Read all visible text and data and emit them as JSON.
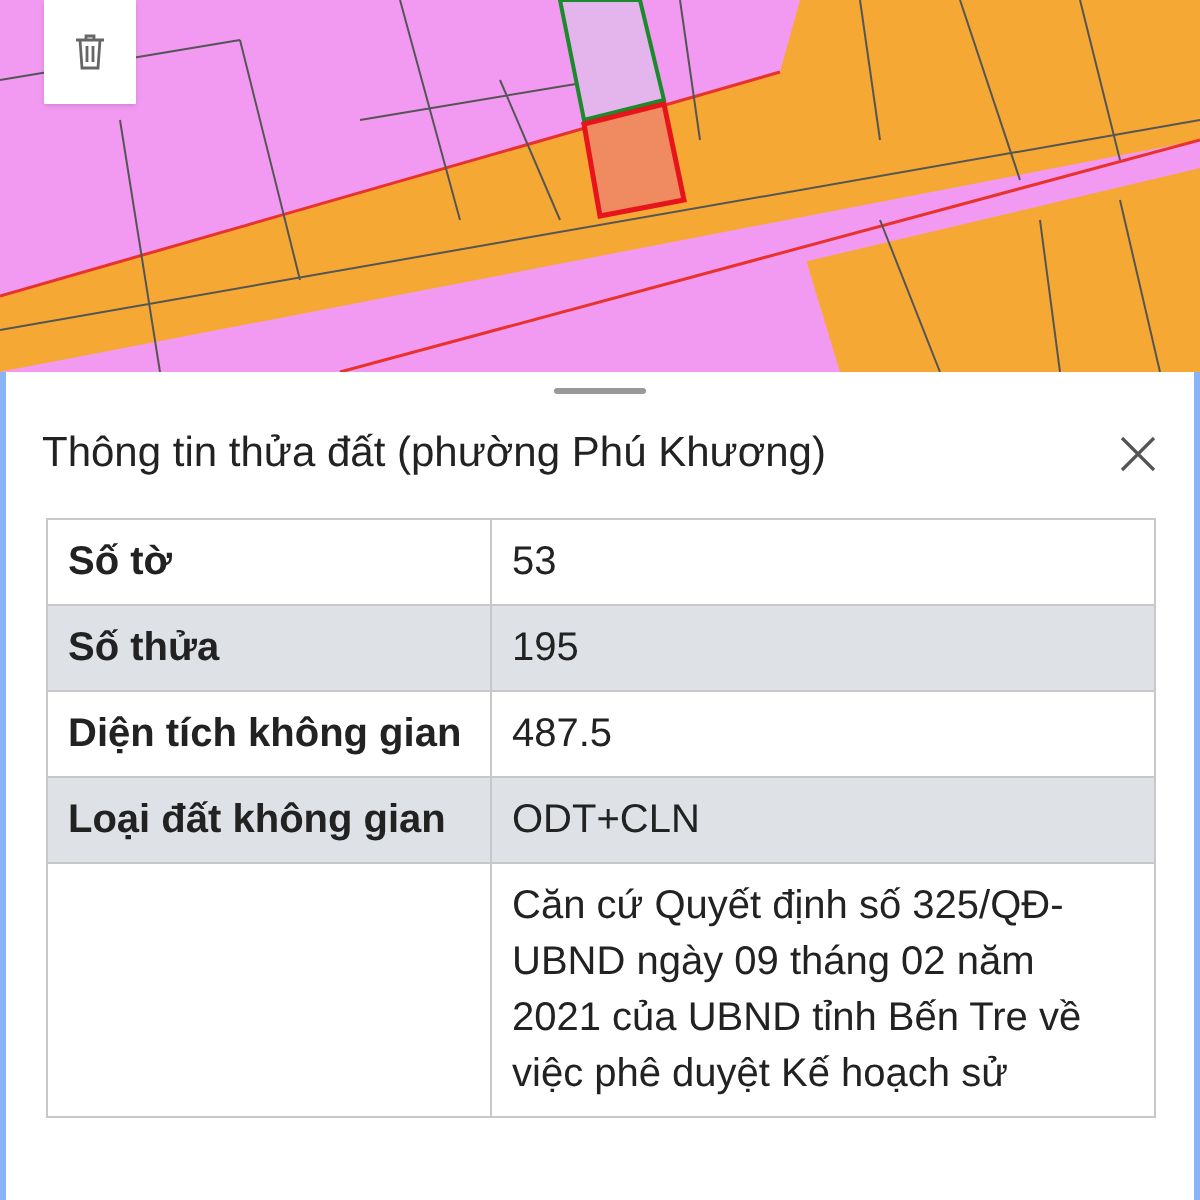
{
  "sheet": {
    "title": "Thông tin thửa đất (phường Phú Khương)",
    "rows": [
      {
        "label": "Số tờ",
        "value": "53"
      },
      {
        "label": "Số thửa",
        "value": "195"
      },
      {
        "label": "Diện tích không gian",
        "value": "487.5"
      },
      {
        "label": "Loại đất không gian",
        "value": "ODT+CLN"
      },
      {
        "value": "Căn cứ Quyết định số 325/QĐ-UBND ngày 09 tháng 02 năm 2021 của UBND tỉnh Bến Tre về việc phê duyệt Kế hoạch sử"
      }
    ]
  }
}
